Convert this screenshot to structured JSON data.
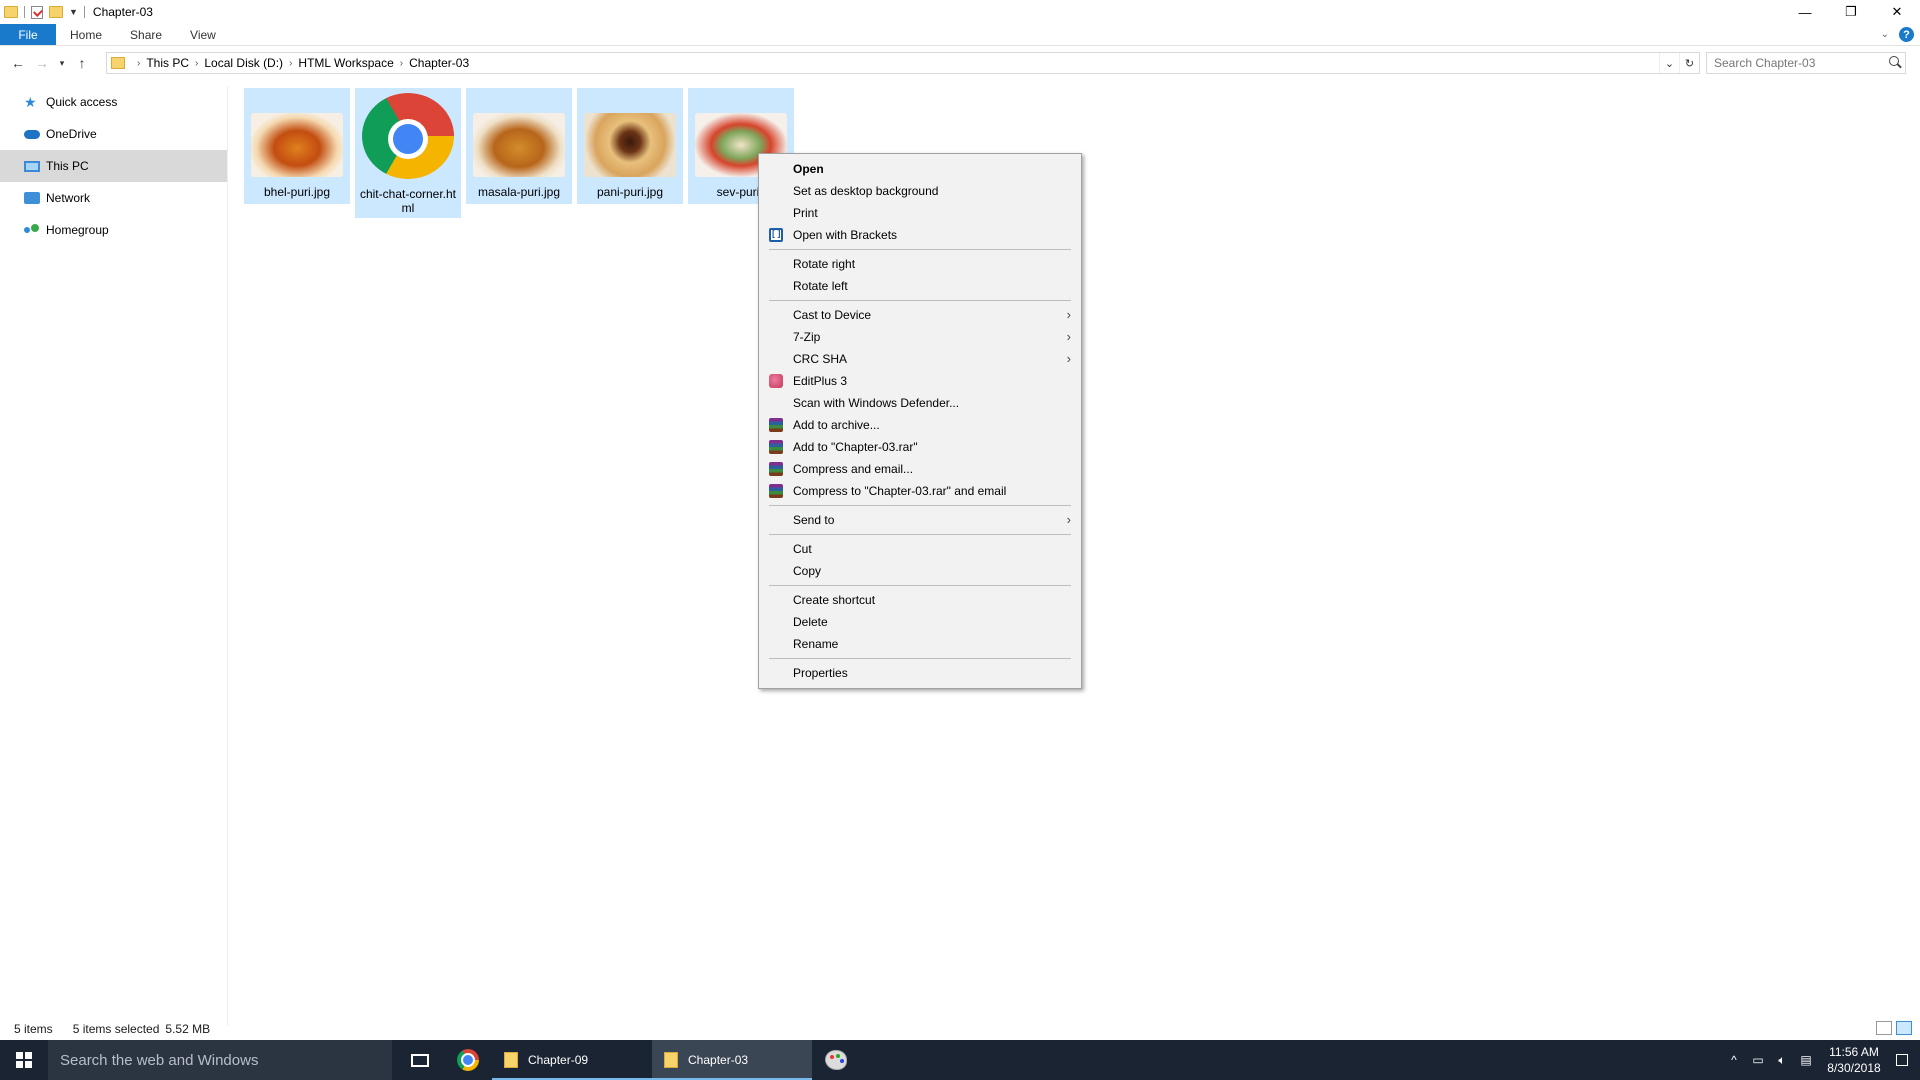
{
  "window": {
    "title": "Chapter-03",
    "minimize": "—",
    "maximize": "❐",
    "close": "✕"
  },
  "ribbon": {
    "tabs": [
      "File",
      "Home",
      "Share",
      "View"
    ],
    "help": "?"
  },
  "address": {
    "crumbs": [
      "This PC",
      "Local Disk (D:)",
      "HTML Workspace",
      "Chapter-03"
    ],
    "search_placeholder": "Search Chapter-03"
  },
  "nav": {
    "items": [
      "Quick access",
      "OneDrive",
      "This PC",
      "Network",
      "Homegroup"
    ],
    "selected": "This PC"
  },
  "files": [
    {
      "name": "bhel-puri.jpg"
    },
    {
      "name": "chit-chat-corner.html"
    },
    {
      "name": "masala-puri.jpg"
    },
    {
      "name": "pani-puri.jpg"
    },
    {
      "name": "sev-puri.j"
    }
  ],
  "context_menu": {
    "open": "Open",
    "set_bg": "Set as desktop background",
    "print": "Print",
    "open_brackets": "Open with Brackets",
    "rotate_right": "Rotate right",
    "rotate_left": "Rotate left",
    "cast": "Cast to Device",
    "zip": "7-Zip",
    "crc": "CRC SHA",
    "editplus": "EditPlus 3",
    "defender": "Scan with Windows Defender...",
    "add_archive": "Add to archive...",
    "add_rar": "Add to \"Chapter-03.rar\"",
    "compress_email": "Compress and email...",
    "compress_rar_email": "Compress to \"Chapter-03.rar\" and email",
    "send_to": "Send to",
    "cut": "Cut",
    "copy": "Copy",
    "create_shortcut": "Create shortcut",
    "delete": "Delete",
    "rename": "Rename",
    "properties": "Properties"
  },
  "status": {
    "count": "5 items",
    "selected": "5 items selected",
    "size": "5.52 MB"
  },
  "taskbar": {
    "search_placeholder": "Search the web and Windows",
    "apps": [
      "Chapter-09",
      "Chapter-03"
    ],
    "time": "11:56 AM",
    "date": "8/30/2018"
  },
  "colors": {
    "accent": "#1979ca",
    "selection": "#cce8ff",
    "taskbar": "#1a2433"
  }
}
